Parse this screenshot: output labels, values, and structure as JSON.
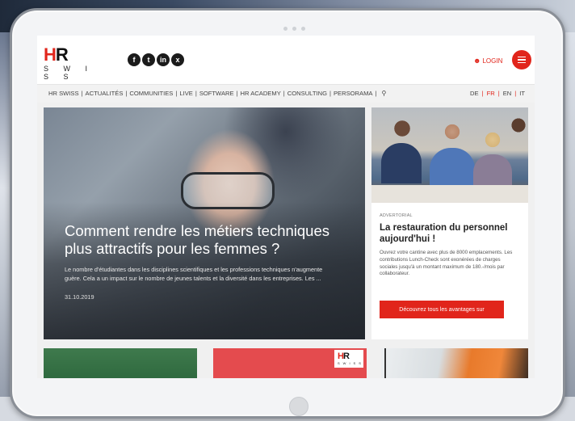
{
  "brand": {
    "logo_top": "HR",
    "logo_bottom": "S W I S S",
    "accent_color": "#e1251b"
  },
  "social_icons": [
    "facebook-icon",
    "twitter-icon",
    "linkedin-icon",
    "xing-icon"
  ],
  "social_glyphs": [
    "f",
    "t",
    "in",
    "x"
  ],
  "header": {
    "login_label": "LOGIN"
  },
  "nav": {
    "items": [
      "HR SWISS",
      "ACTUALITÉS",
      "COMMUNITIES",
      "LIVE",
      "SOFTWARE",
      "HR ACADEMY",
      "CONSULTING",
      "PERSORAMA"
    ],
    "separator": "|",
    "languages": [
      "DE",
      "FR",
      "EN",
      "IT"
    ],
    "active_language": "FR"
  },
  "hero": {
    "title": "Comment rendre les métiers techniques plus attractifs pour les femmes ?",
    "excerpt": "Le nombre d'étudiantes dans les disciplines scientifiques et les professions techniques n'augmente guère. Cela a un impact sur le nombre de jeunes talents et la diversité dans les entreprises. Les ...",
    "date": "31.10.2019"
  },
  "ad": {
    "label": "ADVERTORIAL",
    "title": "La restauration du personnel aujourd'hui !",
    "description": "Ouvrez votre cantine avec plus de 8000 emplacements. Les contributions Lunch-Check sont exonérées de charges sociales jusqu'à un montant maximum de 180.-/mois par collaborateur.",
    "cta_label": "Découvrez tous les avantages sur"
  },
  "teaser": {
    "mini_logo_top": "HR",
    "mini_logo_bottom": "SWISS"
  }
}
